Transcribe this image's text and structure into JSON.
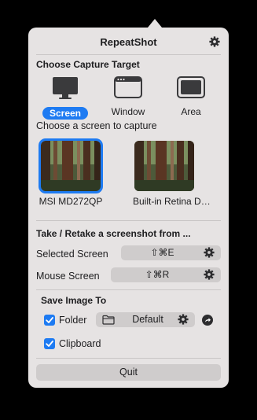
{
  "app": {
    "title": "RepeatShot"
  },
  "capture_target": {
    "heading": "Choose Capture Target",
    "options": [
      {
        "label": "Screen",
        "icon": "monitor-icon",
        "selected": true
      },
      {
        "label": "Window",
        "icon": "window-icon",
        "selected": false
      },
      {
        "label": "Area",
        "icon": "area-icon",
        "selected": false
      }
    ],
    "screen_prompt": "Choose a screen to capture",
    "screens": [
      {
        "label": "MSI MD272QP",
        "selected": true
      },
      {
        "label": "Built-in Retina Display",
        "selected": false
      }
    ]
  },
  "retake": {
    "heading": "Take / Retake a screenshot from ...",
    "selected_screen": {
      "label": "Selected Screen",
      "shortcut": "⇧⌘E"
    },
    "mouse_screen": {
      "label": "Mouse Screen",
      "shortcut": "⇧⌘R"
    }
  },
  "save": {
    "heading": "Save Image To",
    "folder": {
      "label": "Folder",
      "checked": true,
      "value": "Default"
    },
    "clipboard": {
      "label": "Clipboard",
      "checked": true
    }
  },
  "quit_label": "Quit",
  "colors": {
    "accent": "#1e7bf2",
    "panel": "#e6e3e3",
    "button": "#cfcccc"
  }
}
